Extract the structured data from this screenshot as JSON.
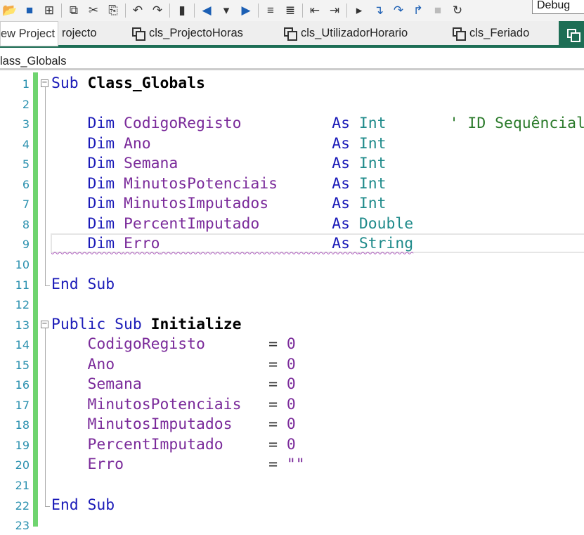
{
  "toolbar": {
    "icons": [
      "folder-icon",
      "save-icon",
      "save-all-icon",
      "copy-icon",
      "cut-icon",
      "paste-icon",
      "undo-icon",
      "redo-icon",
      "bookmark-icon",
      "navigate-back-icon",
      "dropdown-icon",
      "navigate-forward-icon",
      "comment-icon",
      "uncomment-icon",
      "outdent-icon",
      "indent-icon",
      "start-icon",
      "step-into-icon",
      "step-over-icon",
      "step-out-icon",
      "stop-icon",
      "restart-icon"
    ],
    "config": "Debug"
  },
  "tabs": {
    "tooltip": "ew Project",
    "items": [
      "rojecto",
      "cls_ProjectoHoras",
      "cls_UtilizadorHorario",
      "cls_Feriado"
    ]
  },
  "breadcrumb": "lass_Globals",
  "colors": {
    "keyword": "#1a1ab8",
    "identifier": "#7a2a9a",
    "type": "#1e8a8a",
    "comment": "#2a7a2a",
    "accent": "#1d6e55"
  },
  "code": [
    [
      [
        "Sub ",
        "k"
      ],
      [
        "Class_Globals",
        "b"
      ]
    ],
    [],
    [
      [
        "    Dim ",
        "k"
      ],
      [
        "CodigoRegisto",
        "i"
      ],
      [
        "          ",
        "p"
      ],
      [
        "As ",
        "k"
      ],
      [
        "Int",
        "t"
      ],
      [
        "       ' ID Sequêncial",
        "c"
      ]
    ],
    [
      [
        "    Dim ",
        "k"
      ],
      [
        "Ano",
        "i"
      ],
      [
        "                    ",
        "p"
      ],
      [
        "As ",
        "k"
      ],
      [
        "Int",
        "t"
      ]
    ],
    [
      [
        "    Dim ",
        "k"
      ],
      [
        "Semana",
        "i"
      ],
      [
        "                 ",
        "p"
      ],
      [
        "As ",
        "k"
      ],
      [
        "Int",
        "t"
      ]
    ],
    [
      [
        "    Dim ",
        "k"
      ],
      [
        "MinutosPotenciais",
        "i"
      ],
      [
        "      ",
        "p"
      ],
      [
        "As ",
        "k"
      ],
      [
        "Int",
        "t"
      ]
    ],
    [
      [
        "    Dim ",
        "k"
      ],
      [
        "MinutosImputados",
        "i"
      ],
      [
        "       ",
        "p"
      ],
      [
        "As ",
        "k"
      ],
      [
        "Int",
        "t"
      ]
    ],
    [
      [
        "    Dim ",
        "k"
      ],
      [
        "PercentImputado",
        "i"
      ],
      [
        "        ",
        "p"
      ],
      [
        "As ",
        "k"
      ],
      [
        "Double",
        "t"
      ]
    ],
    [
      [
        "    Dim ",
        "k"
      ],
      [
        "Erro",
        "i"
      ],
      [
        "                   ",
        "p"
      ],
      [
        "As ",
        "k"
      ],
      [
        "String",
        "t"
      ]
    ],
    [],
    [
      [
        "End Sub",
        "k"
      ]
    ],
    [],
    [
      [
        "Public Sub ",
        "k"
      ],
      [
        "Initialize",
        "b"
      ]
    ],
    [
      [
        "    CodigoRegisto",
        "i"
      ],
      [
        "       = ",
        "p"
      ],
      [
        "0",
        "i"
      ]
    ],
    [
      [
        "    Ano",
        "i"
      ],
      [
        "                 = ",
        "p"
      ],
      [
        "0",
        "i"
      ]
    ],
    [
      [
        "    Semana",
        "i"
      ],
      [
        "              = ",
        "p"
      ],
      [
        "0",
        "i"
      ]
    ],
    [
      [
        "    MinutosPotenciais",
        "i"
      ],
      [
        "   = ",
        "p"
      ],
      [
        "0",
        "i"
      ]
    ],
    [
      [
        "    MinutosImputados",
        "i"
      ],
      [
        "    = ",
        "p"
      ],
      [
        "0",
        "i"
      ]
    ],
    [
      [
        "    PercentImputado",
        "i"
      ],
      [
        "     = ",
        "p"
      ],
      [
        "0",
        "i"
      ]
    ],
    [
      [
        "    Erro",
        "i"
      ],
      [
        "                = ",
        "p"
      ],
      [
        "\"\"",
        "i"
      ]
    ],
    [],
    [
      [
        "End Sub",
        "k"
      ]
    ],
    []
  ]
}
